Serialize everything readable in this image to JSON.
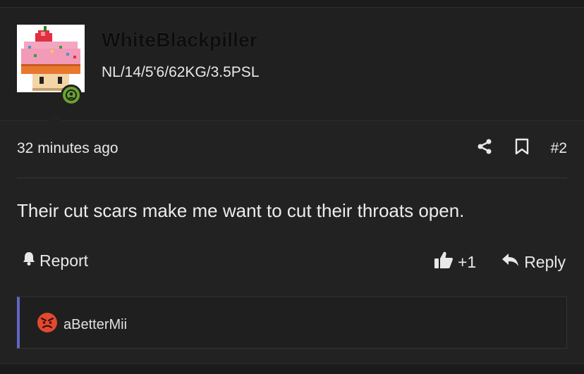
{
  "user": {
    "username": "WhiteBlackpiller",
    "title": "NL/14/5'6/62KG/3.5PSL",
    "status": "online"
  },
  "post": {
    "time": "32 minutes ago",
    "number": "#2",
    "body": "Their cut scars make me want to cut their throats open."
  },
  "actions": {
    "report": "Report",
    "like_count": "+1",
    "reply": "Reply"
  },
  "reactions": [
    {
      "user": "aBetterMii",
      "icon": "angry-face-icon"
    }
  ],
  "colors": {
    "online": "#6aa32f",
    "reaction_border": "#6066c4",
    "angry": "#e2492f"
  }
}
